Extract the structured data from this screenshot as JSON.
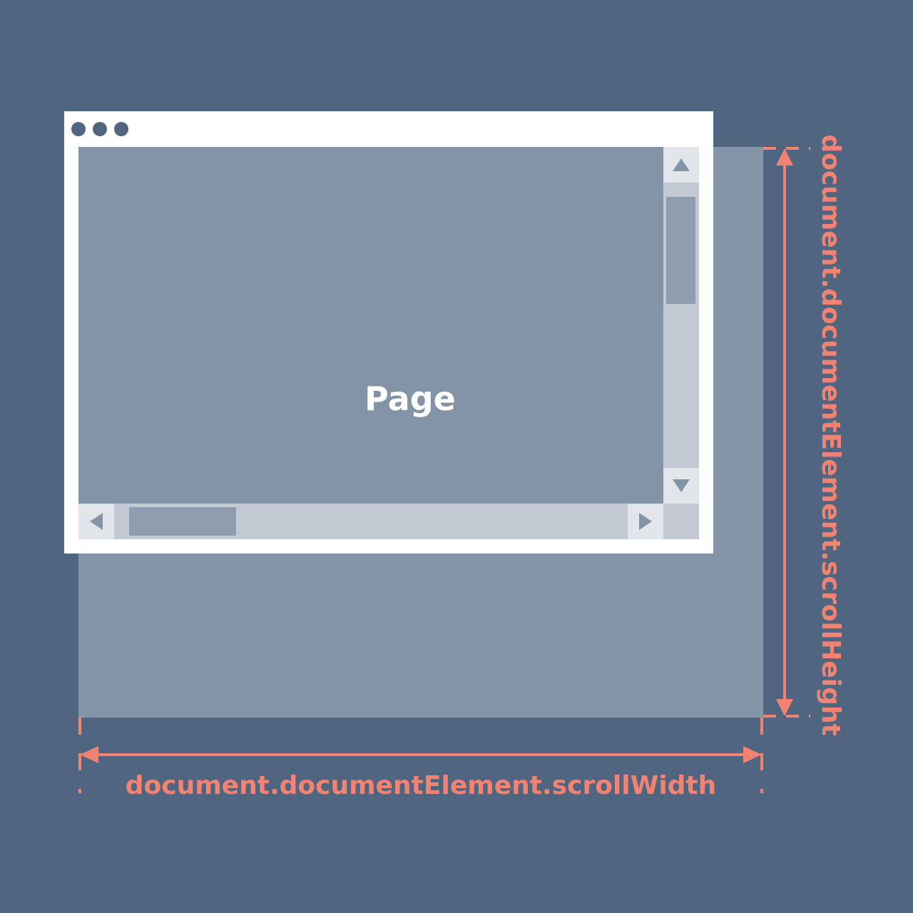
{
  "page": {
    "label": "Page"
  },
  "browser": {
    "window_dots": [
      "window-dot-1",
      "window-dot-2",
      "window-dot-3"
    ]
  },
  "measurements": {
    "scroll_width_label": "document.documentElement.scrollWidth",
    "scroll_height_label": "document.documentElement.scrollHeight"
  },
  "colors": {
    "background": "#50657f",
    "page": "#8394a6",
    "window": "#ffffff",
    "scrollbar_track": "#c2c9d2",
    "scrollbar_button": "#e2e6ea",
    "scrollbar_thumb": "#8f9dae",
    "annotation": "#f28373"
  },
  "icons": [
    "triangle-up-icon",
    "triangle-down-icon",
    "triangle-left-icon",
    "triangle-right-icon",
    "double-arrow-icon"
  ]
}
